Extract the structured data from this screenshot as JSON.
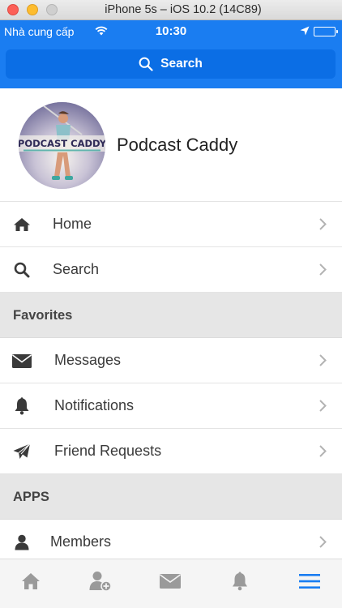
{
  "window": {
    "title": "iPhone 5s – iOS 10.2 (14C89)"
  },
  "status_bar": {
    "carrier": "Nhà cung cấp",
    "time": "10:30",
    "battery_level": 1.0
  },
  "search": {
    "label": "Search"
  },
  "profile": {
    "name": "Podcast Caddy",
    "logo_text": "PODCAST CADDY"
  },
  "menu": {
    "items": [
      {
        "label": "Home",
        "icon": "home-icon"
      },
      {
        "label": "Search",
        "icon": "search-icon"
      }
    ],
    "favorites": {
      "title": "Favorites",
      "items": [
        {
          "label": "Messages",
          "icon": "envelope-icon"
        },
        {
          "label": "Notifications",
          "icon": "bell-icon"
        },
        {
          "label": "Friend Requests",
          "icon": "paper-plane-icon"
        }
      ]
    },
    "apps": {
      "title": "APPS",
      "items": [
        {
          "label": "Members",
          "icon": "user-icon"
        }
      ]
    }
  },
  "tabbar": {
    "tabs": [
      {
        "icon": "home-icon"
      },
      {
        "icon": "add-user-icon"
      },
      {
        "icon": "envelope-icon"
      },
      {
        "icon": "bell-icon"
      },
      {
        "icon": "menu-icon",
        "active": true
      }
    ]
  },
  "colors": {
    "brand_blue": "#1a7df1",
    "search_bar": "#0b6ee5",
    "section_bg": "#e6e6e6",
    "tab_icon": "#9a9a9a",
    "tab_active": "#1a7df1"
  }
}
